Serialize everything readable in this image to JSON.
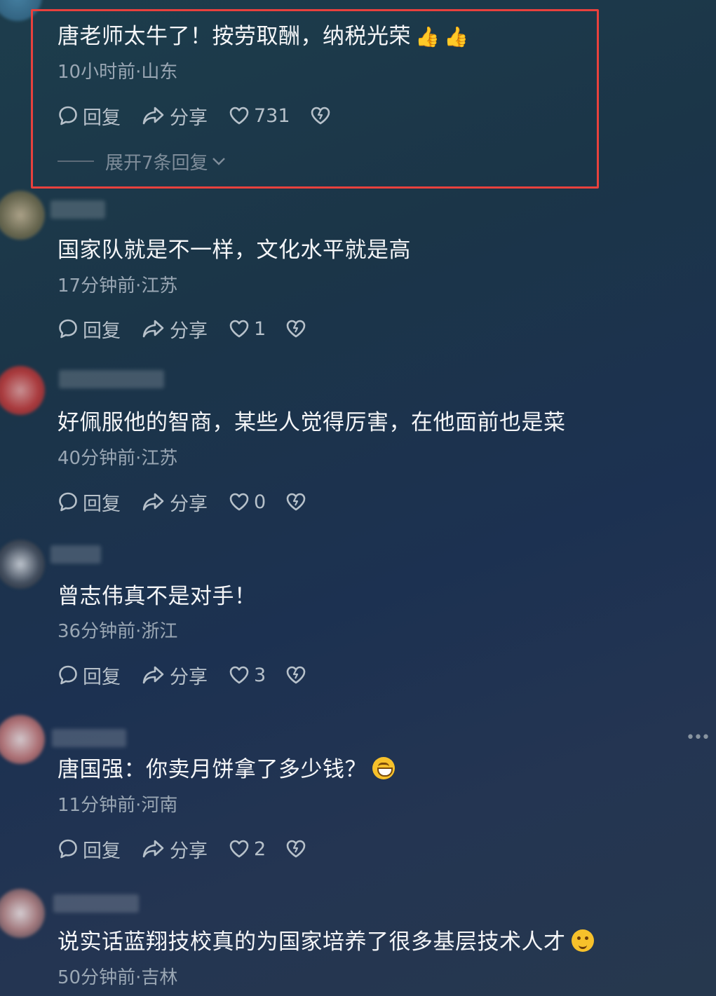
{
  "comments": [
    {
      "text": "唐老师太牛了！按劳取酬，纳税光荣",
      "meta": "10小时前·山东",
      "reply": "回复",
      "share": "分享",
      "likes": "731",
      "expand": "展开7条回复"
    },
    {
      "text": "国家队就是不一样，文化水平就是高",
      "meta": "17分钟前·江苏",
      "reply": "回复",
      "share": "分享",
      "likes": "1"
    },
    {
      "text": "好佩服他的智商，某些人觉得厉害，在他面前也是菜",
      "meta": "40分钟前·江苏",
      "reply": "回复",
      "share": "分享",
      "likes": "0"
    },
    {
      "text": "曾志伟真不是对手！",
      "meta": "36分钟前·浙江",
      "reply": "回复",
      "share": "分享",
      "likes": "3"
    },
    {
      "text": "唐国强：你卖月饼拿了多少钱？",
      "meta": "11分钟前·河南",
      "reply": "回复",
      "share": "分享",
      "likes": "2"
    },
    {
      "text": "说实话蓝翔技校真的为国家培养了很多基层技术人才",
      "meta": "50分钟前·吉林"
    }
  ],
  "icons": {
    "reply": "speech-bubble-icon",
    "share": "share-arrow-icon",
    "like": "heart-icon",
    "dislike": "broken-heart-icon",
    "thumbs_up": "thumbs-up-emoji",
    "grin": "grinning-emoji",
    "wink": "smirk-emoji"
  },
  "colors": {
    "highlight_border": "#e8413d",
    "accent_emoji": "#f7c12b"
  }
}
